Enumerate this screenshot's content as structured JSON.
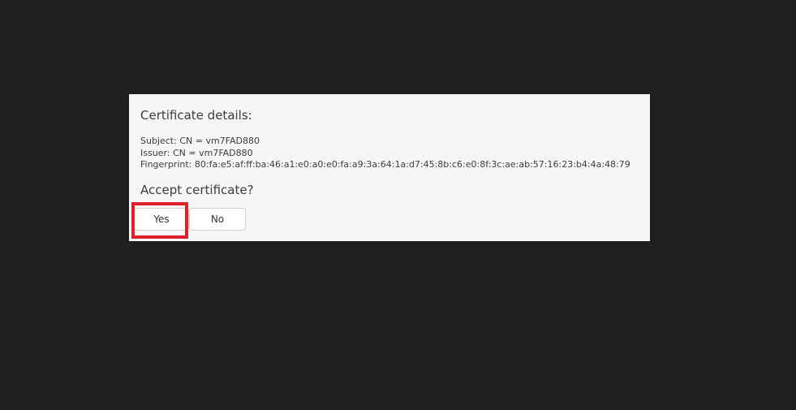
{
  "dialog": {
    "heading": "Certificate details:",
    "subject": "Subject: CN = vm7FAD880",
    "issuer": "Issuer: CN = vm7FAD880",
    "fingerprint": "Fingerprint: 80:fa:e5:af:ff:ba:46:a1:e0:a0:e0:fa:a9:3a:64:1a:d7:45:8b:c6:e0:8f:3c:ae:ab:57:16:23:b4:4a:48:79",
    "prompt": "Accept certificate?",
    "yes_label": "Yes",
    "no_label": "No"
  },
  "colors": {
    "background": "#1f1f1f",
    "dialog_background": "#f6f6f6",
    "highlight": "#e0202b"
  }
}
